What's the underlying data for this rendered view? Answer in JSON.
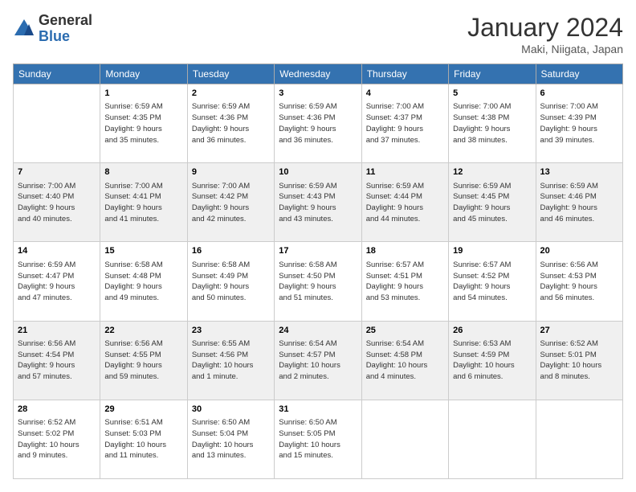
{
  "header": {
    "logo": {
      "line1": "General",
      "line2": "Blue"
    },
    "title": "January 2024",
    "location": "Maki, Niigata, Japan"
  },
  "weekdays": [
    "Sunday",
    "Monday",
    "Tuesday",
    "Wednesday",
    "Thursday",
    "Friday",
    "Saturday"
  ],
  "weeks": [
    [
      {
        "day": "",
        "info": ""
      },
      {
        "day": "1",
        "info": "Sunrise: 6:59 AM\nSunset: 4:35 PM\nDaylight: 9 hours\nand 35 minutes."
      },
      {
        "day": "2",
        "info": "Sunrise: 6:59 AM\nSunset: 4:36 PM\nDaylight: 9 hours\nand 36 minutes."
      },
      {
        "day": "3",
        "info": "Sunrise: 6:59 AM\nSunset: 4:36 PM\nDaylight: 9 hours\nand 36 minutes."
      },
      {
        "day": "4",
        "info": "Sunrise: 7:00 AM\nSunset: 4:37 PM\nDaylight: 9 hours\nand 37 minutes."
      },
      {
        "day": "5",
        "info": "Sunrise: 7:00 AM\nSunset: 4:38 PM\nDaylight: 9 hours\nand 38 minutes."
      },
      {
        "day": "6",
        "info": "Sunrise: 7:00 AM\nSunset: 4:39 PM\nDaylight: 9 hours\nand 39 minutes."
      }
    ],
    [
      {
        "day": "7",
        "info": ""
      },
      {
        "day": "8",
        "info": "Sunrise: 7:00 AM\nSunset: 4:41 PM\nDaylight: 9 hours\nand 41 minutes."
      },
      {
        "day": "9",
        "info": "Sunrise: 7:00 AM\nSunset: 4:42 PM\nDaylight: 9 hours\nand 42 minutes."
      },
      {
        "day": "10",
        "info": "Sunrise: 6:59 AM\nSunset: 4:43 PM\nDaylight: 9 hours\nand 43 minutes."
      },
      {
        "day": "11",
        "info": "Sunrise: 6:59 AM\nSunset: 4:44 PM\nDaylight: 9 hours\nand 44 minutes."
      },
      {
        "day": "12",
        "info": "Sunrise: 6:59 AM\nSunset: 4:45 PM\nDaylight: 9 hours\nand 45 minutes."
      },
      {
        "day": "13",
        "info": "Sunrise: 6:59 AM\nSunset: 4:46 PM\nDaylight: 9 hours\nand 46 minutes."
      }
    ],
    [
      {
        "day": "14",
        "info": "Sunrise: 6:59 AM\nSunset: 4:47 PM\nDaylight: 9 hours\nand 47 minutes."
      },
      {
        "day": "15",
        "info": "Sunrise: 6:58 AM\nSunset: 4:48 PM\nDaylight: 9 hours\nand 49 minutes."
      },
      {
        "day": "16",
        "info": "Sunrise: 6:58 AM\nSunset: 4:49 PM\nDaylight: 9 hours\nand 50 minutes."
      },
      {
        "day": "17",
        "info": "Sunrise: 6:58 AM\nSunset: 4:50 PM\nDaylight: 9 hours\nand 51 minutes."
      },
      {
        "day": "18",
        "info": "Sunrise: 6:57 AM\nSunset: 4:51 PM\nDaylight: 9 hours\nand 53 minutes."
      },
      {
        "day": "19",
        "info": "Sunrise: 6:57 AM\nSunset: 4:52 PM\nDaylight: 9 hours\nand 54 minutes."
      },
      {
        "day": "20",
        "info": "Sunrise: 6:56 AM\nSunset: 4:53 PM\nDaylight: 9 hours\nand 56 minutes."
      }
    ],
    [
      {
        "day": "21",
        "info": "Sunrise: 6:56 AM\nSunset: 4:54 PM\nDaylight: 9 hours\nand 57 minutes."
      },
      {
        "day": "22",
        "info": "Sunrise: 6:56 AM\nSunset: 4:55 PM\nDaylight: 9 hours\nand 59 minutes."
      },
      {
        "day": "23",
        "info": "Sunrise: 6:55 AM\nSunset: 4:56 PM\nDaylight: 10 hours\nand 1 minute."
      },
      {
        "day": "24",
        "info": "Sunrise: 6:54 AM\nSunset: 4:57 PM\nDaylight: 10 hours\nand 2 minutes."
      },
      {
        "day": "25",
        "info": "Sunrise: 6:54 AM\nSunset: 4:58 PM\nDaylight: 10 hours\nand 4 minutes."
      },
      {
        "day": "26",
        "info": "Sunrise: 6:53 AM\nSunset: 4:59 PM\nDaylight: 10 hours\nand 6 minutes."
      },
      {
        "day": "27",
        "info": "Sunrise: 6:52 AM\nSunset: 5:01 PM\nDaylight: 10 hours\nand 8 minutes."
      }
    ],
    [
      {
        "day": "28",
        "info": "Sunrise: 6:52 AM\nSunset: 5:02 PM\nDaylight: 10 hours\nand 9 minutes."
      },
      {
        "day": "29",
        "info": "Sunrise: 6:51 AM\nSunset: 5:03 PM\nDaylight: 10 hours\nand 11 minutes."
      },
      {
        "day": "30",
        "info": "Sunrise: 6:50 AM\nSunset: 5:04 PM\nDaylight: 10 hours\nand 13 minutes."
      },
      {
        "day": "31",
        "info": "Sunrise: 6:50 AM\nSunset: 5:05 PM\nDaylight: 10 hours\nand 15 minutes."
      },
      {
        "day": "",
        "info": ""
      },
      {
        "day": "",
        "info": ""
      },
      {
        "day": "",
        "info": ""
      }
    ]
  ],
  "week1_sun_info": "Sunrise: 7:00 AM\nSunset: 4:40 PM\nDaylight: 9 hours\nand 40 minutes."
}
